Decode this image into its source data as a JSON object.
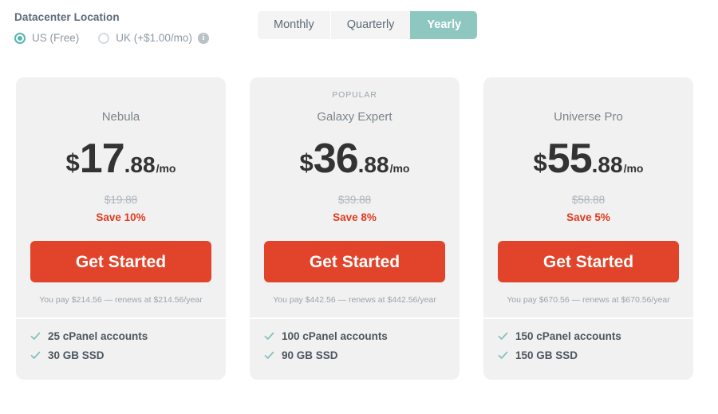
{
  "datacenter": {
    "title": "Datacenter Location",
    "options": [
      {
        "label": "US (Free)",
        "selected": true
      },
      {
        "label": "UK (+$1.00/mo)",
        "selected": false
      }
    ],
    "info_icon": "info-icon",
    "info_glyph": "i"
  },
  "billing_cycle": {
    "tabs": [
      {
        "label": "Monthly",
        "active": false
      },
      {
        "label": "Quarterly",
        "active": false
      },
      {
        "label": "Yearly",
        "active": true
      }
    ]
  },
  "colors": {
    "accent_teal": "#8ec6c0",
    "radio_teal": "#56b6ad",
    "cta_orange": "#e1442a",
    "save_red": "#e03a1e",
    "card_bg": "#f1f1f1",
    "check_teal": "#7fc0ba"
  },
  "plans": [
    {
      "badge": "",
      "name": "Nebula",
      "currency": "$",
      "price_int": "17",
      "price_dec": ".88",
      "per": "/mo",
      "old_price": "$19.88",
      "save": "Save 10%",
      "cta": "Get Started",
      "renew_note": "You pay $214.56 — renews at $214.56/year",
      "features": [
        "25 cPanel accounts",
        "30 GB SSD"
      ]
    },
    {
      "badge": "POPULAR",
      "name": "Galaxy Expert",
      "currency": "$",
      "price_int": "36",
      "price_dec": ".88",
      "per": "/mo",
      "old_price": "$39.88",
      "save": "Save 8%",
      "cta": "Get Started",
      "renew_note": "You pay $442.56 — renews at $442.56/year",
      "features": [
        "100 cPanel accounts",
        "90 GB SSD"
      ]
    },
    {
      "badge": "",
      "name": "Universe Pro",
      "currency": "$",
      "price_int": "55",
      "price_dec": ".88",
      "per": "/mo",
      "old_price": "$58.88",
      "save": "Save 5%",
      "cta": "Get Started",
      "renew_note": "You pay $670.56 — renews at $670.56/year",
      "features": [
        "150 cPanel accounts",
        "150 GB SSD"
      ]
    }
  ]
}
